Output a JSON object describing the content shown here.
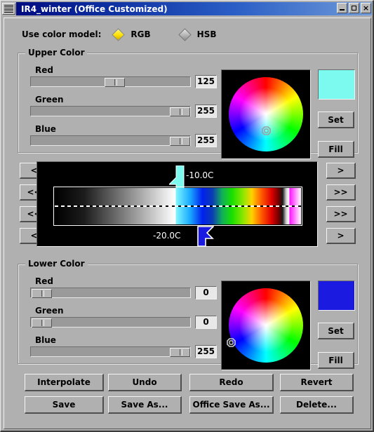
{
  "window": {
    "title": "IR4_winter (Office Customized)",
    "menu_icon": "window-menu-icon",
    "buttons": {
      "minimize": "_",
      "maximize": "□",
      "close": "×"
    },
    "titlebar_color": "#0d2fa0",
    "face_color": "#b0b0b0"
  },
  "color_model": {
    "label": "Use color model:",
    "options": [
      {
        "label": "RGB",
        "selected": true
      },
      {
        "label": "HSB",
        "selected": false
      }
    ],
    "selected_accent": "#ffe000"
  },
  "upper_color": {
    "title": "Upper Color",
    "channels": [
      {
        "name": "Red",
        "value": "125",
        "percent": 49.0
      },
      {
        "name": "Green",
        "value": "255",
        "percent": 100.0
      },
      {
        "name": "Blue",
        "value": "255",
        "percent": 100.0
      }
    ],
    "swatch_color": "#7dfaf0",
    "wheel_marker": {
      "x_pct": 50.0,
      "y_pct": 74.0
    },
    "set_label": "Set",
    "fill_label": "Fill"
  },
  "lower_color": {
    "title": "Lower Color",
    "channels": [
      {
        "name": "Red",
        "value": "0",
        "percent": 0.0
      },
      {
        "name": "Green",
        "value": "0",
        "percent": 0.0
      },
      {
        "name": "Blue",
        "value": "255",
        "percent": 100.0
      }
    ],
    "swatch_color": "#1a1ae0",
    "wheel_marker": {
      "x_pct": 6.0,
      "y_pct": 71.0
    },
    "set_label": "Set",
    "fill_label": "Fill"
  },
  "colorbar": {
    "left_buttons": [
      "<",
      "<<",
      "<<",
      "<"
    ],
    "right_buttons": [
      ">",
      ">>",
      ">>",
      ">"
    ],
    "upper_marker": {
      "label": "-10.0C",
      "position_pct": 49.0,
      "color": "#7dfaf0"
    },
    "lower_marker": {
      "label": "-20.0C",
      "position_pct": 58.0,
      "color": "#1a1ae0"
    },
    "gradient_stops": [
      {
        "pos": 0,
        "color": "#000000"
      },
      {
        "pos": 12,
        "color": "#1c1c1c"
      },
      {
        "pos": 30,
        "color": "#8a8a8a"
      },
      {
        "pos": 45,
        "color": "#e8e8e8"
      },
      {
        "pos": 49,
        "color": "#ffffff"
      },
      {
        "pos": 49.3,
        "color": "#7df6ff"
      },
      {
        "pos": 55,
        "color": "#1aa8ff"
      },
      {
        "pos": 60,
        "color": "#0020ee"
      },
      {
        "pos": 64,
        "color": "#0b3bb4"
      },
      {
        "pos": 68,
        "color": "#11b05a"
      },
      {
        "pos": 72,
        "color": "#18e000"
      },
      {
        "pos": 77,
        "color": "#9ae600"
      },
      {
        "pos": 80,
        "color": "#ffd200"
      },
      {
        "pos": 84,
        "color": "#ff5a00"
      },
      {
        "pos": 88,
        "color": "#e00000"
      },
      {
        "pos": 91,
        "color": "#6e0000"
      },
      {
        "pos": 92.5,
        "color": "#1a1a1a"
      },
      {
        "pos": 94,
        "color": "#cfcfcf"
      },
      {
        "pos": 95,
        "color": "#ffffff"
      },
      {
        "pos": 95.5,
        "color": "#ff18ff"
      },
      {
        "pos": 100,
        "color": "#ffffff"
      }
    ]
  },
  "actions": {
    "row1": [
      "Interpolate",
      "Undo",
      "Redo",
      "Revert"
    ],
    "row2": [
      "Save",
      "Save As...",
      "Office Save As...",
      "Delete..."
    ]
  }
}
